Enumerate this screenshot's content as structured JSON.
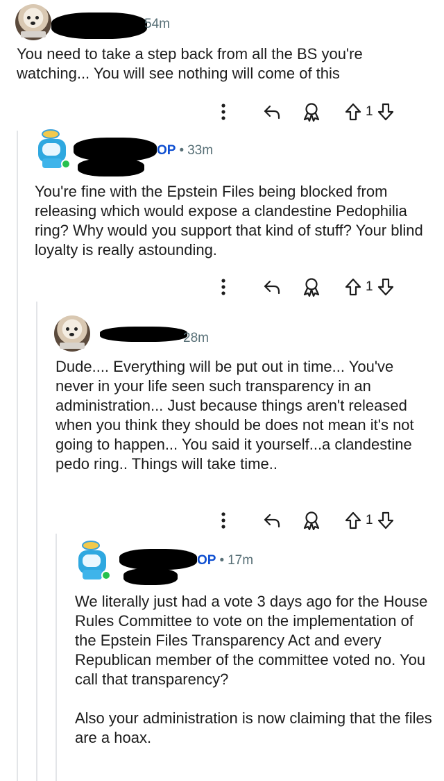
{
  "comments": [
    {
      "timestamp": "54m",
      "is_op": false,
      "text": [
        "You need to take a step back from all the BS you're watching... You will see nothing will come of this"
      ],
      "votes": "1"
    },
    {
      "timestamp": "33m",
      "is_op": true,
      "op_label": "OP",
      "separator": "•",
      "text": [
        "You're fine with the Epstein Files being blocked from releasing which would expose a clandestine Pedophilia ring? Why would you support that kind of stuff? Your blind loyalty is really astounding."
      ],
      "votes": "1"
    },
    {
      "timestamp": "28m",
      "is_op": false,
      "text": [
        "Dude.... Everything will be put out in time... You've never in your life seen such transparency in an administration... Just because things aren't released when you think they should be does not mean it's not going to happen... You said it yourself...a clandestine pedo ring.. Things will take time.."
      ],
      "votes": "1"
    },
    {
      "timestamp": "17m",
      "is_op": true,
      "op_label": "OP",
      "separator": "•",
      "text": [
        "We literally just had a vote 3 days ago for the House Rules Committee to vote on the implementation of the Epstein Files Transparency Act and every Republican member of the committee voted no. You call that transparency?",
        "Also your administration is now claiming that the files are a hoax."
      ]
    }
  ],
  "icons": {
    "more": "more-vertical-icon",
    "reply": "reply-icon",
    "award": "award-icon",
    "upvote": "upvote-arrow-icon",
    "downvote": "downvote-arrow-icon"
  },
  "colors": {
    "op": "#0f4fd1",
    "meta": "#576f76",
    "online": "#26c14e",
    "thread_line": "#e3e5e8"
  }
}
